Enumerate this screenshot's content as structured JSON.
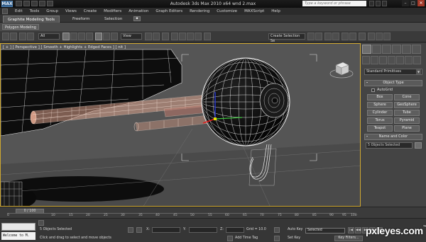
{
  "window": {
    "app_title": "Autodesk 3ds Max  2010 x64    wnd 2.max",
    "search_placeholder": "Type a keyword or phrase",
    "controls": {
      "minimize": "–",
      "maximize": "□",
      "close": "✕"
    },
    "logo_text": "MAX"
  },
  "menu": {
    "items": [
      "Edit",
      "Tools",
      "Group",
      "Views",
      "Create",
      "Modifiers",
      "Animation",
      "Graph Editors",
      "Rendering",
      "Customize",
      "MAXScript",
      "Help"
    ]
  },
  "ribbon": {
    "tabs": [
      "Graphite Modeling Tools",
      "Freeform",
      "Selection"
    ],
    "tab_button": "▪",
    "sub_label": "Polygon Modeling"
  },
  "toolbar": {
    "filter_dropdown": "All",
    "view_dropdown": "View",
    "named_selection": "Create Selection Se"
  },
  "viewport": {
    "label": "[ + ] [ Perspective ] [ Smooth + Highlights + Edged Faces ]  [ nit ]",
    "viewcube_icon": "viewcube-icon"
  },
  "command_panel": {
    "category_dropdown": "Standard Primitives",
    "object_type_title": "Object Type",
    "autogrid_label": "AutoGrid",
    "buttons": [
      "Box",
      "Cone",
      "Sphere",
      "GeoSphere",
      "Cylinder",
      "Tube",
      "Torus",
      "Pyramid",
      "Teapot",
      "Plane"
    ],
    "name_color_title": "Name and Color",
    "name_field": "5 Objects Selected",
    "rollout_sign": "-"
  },
  "timeline": {
    "slider_label": "0 / 100",
    "ticks": [
      "0",
      "10",
      "15",
      "20",
      "25",
      "30",
      "35",
      "40",
      "45",
      "50",
      "55",
      "60",
      "65",
      "70",
      "75",
      "80",
      "85",
      "90",
      "95",
      "100"
    ]
  },
  "status": {
    "maxscript_text": "Welcome to M.",
    "selection_text": "5 Objects Selected",
    "prompt_text": "Click and drag to select and move objects",
    "x_label": "X:",
    "y_label": "Y:",
    "z_label": "Z:",
    "grid_text": "Grid = 10.0",
    "add_time_tag": "Add Time Tag",
    "auto_key": "Auto Key",
    "set_key": "Set Key",
    "selected_dropdown": "Selected",
    "key_filters": "Key Filters...",
    "play_buttons": [
      "|◀",
      "◀◀",
      "▶",
      "▶▶",
      "▶|"
    ]
  },
  "watermark": {
    "text": "pxleyes.com",
    "trademark": "™"
  }
}
